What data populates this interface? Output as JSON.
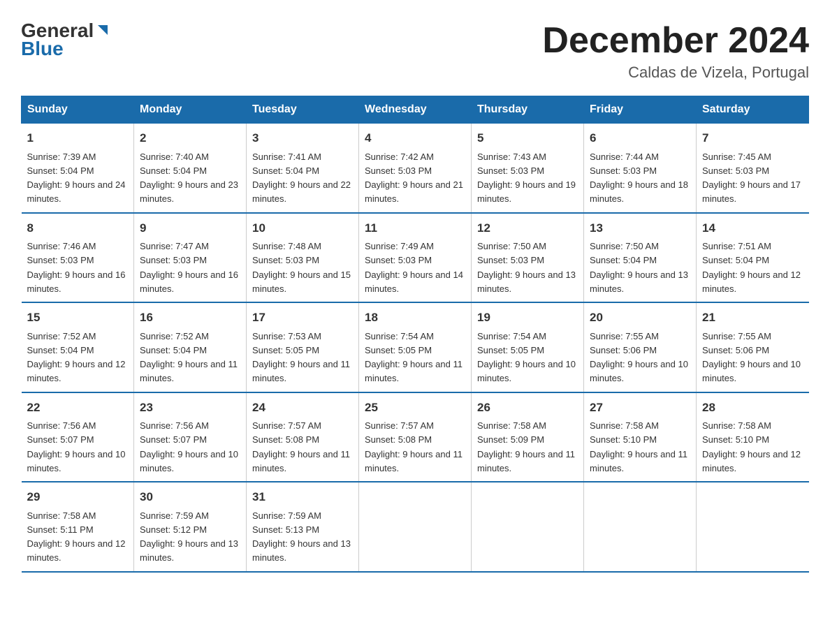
{
  "header": {
    "logo_general": "General",
    "logo_blue": "Blue",
    "month_title": "December 2024",
    "location": "Caldas de Vizela, Portugal"
  },
  "days_of_week": [
    "Sunday",
    "Monday",
    "Tuesday",
    "Wednesday",
    "Thursday",
    "Friday",
    "Saturday"
  ],
  "weeks": [
    [
      {
        "day": "1",
        "sunrise": "7:39 AM",
        "sunset": "5:04 PM",
        "daylight": "9 hours and 24 minutes."
      },
      {
        "day": "2",
        "sunrise": "7:40 AM",
        "sunset": "5:04 PM",
        "daylight": "9 hours and 23 minutes."
      },
      {
        "day": "3",
        "sunrise": "7:41 AM",
        "sunset": "5:04 PM",
        "daylight": "9 hours and 22 minutes."
      },
      {
        "day": "4",
        "sunrise": "7:42 AM",
        "sunset": "5:03 PM",
        "daylight": "9 hours and 21 minutes."
      },
      {
        "day": "5",
        "sunrise": "7:43 AM",
        "sunset": "5:03 PM",
        "daylight": "9 hours and 19 minutes."
      },
      {
        "day": "6",
        "sunrise": "7:44 AM",
        "sunset": "5:03 PM",
        "daylight": "9 hours and 18 minutes."
      },
      {
        "day": "7",
        "sunrise": "7:45 AM",
        "sunset": "5:03 PM",
        "daylight": "9 hours and 17 minutes."
      }
    ],
    [
      {
        "day": "8",
        "sunrise": "7:46 AM",
        "sunset": "5:03 PM",
        "daylight": "9 hours and 16 minutes."
      },
      {
        "day": "9",
        "sunrise": "7:47 AM",
        "sunset": "5:03 PM",
        "daylight": "9 hours and 16 minutes."
      },
      {
        "day": "10",
        "sunrise": "7:48 AM",
        "sunset": "5:03 PM",
        "daylight": "9 hours and 15 minutes."
      },
      {
        "day": "11",
        "sunrise": "7:49 AM",
        "sunset": "5:03 PM",
        "daylight": "9 hours and 14 minutes."
      },
      {
        "day": "12",
        "sunrise": "7:50 AM",
        "sunset": "5:03 PM",
        "daylight": "9 hours and 13 minutes."
      },
      {
        "day": "13",
        "sunrise": "7:50 AM",
        "sunset": "5:04 PM",
        "daylight": "9 hours and 13 minutes."
      },
      {
        "day": "14",
        "sunrise": "7:51 AM",
        "sunset": "5:04 PM",
        "daylight": "9 hours and 12 minutes."
      }
    ],
    [
      {
        "day": "15",
        "sunrise": "7:52 AM",
        "sunset": "5:04 PM",
        "daylight": "9 hours and 12 minutes."
      },
      {
        "day": "16",
        "sunrise": "7:52 AM",
        "sunset": "5:04 PM",
        "daylight": "9 hours and 11 minutes."
      },
      {
        "day": "17",
        "sunrise": "7:53 AM",
        "sunset": "5:05 PM",
        "daylight": "9 hours and 11 minutes."
      },
      {
        "day": "18",
        "sunrise": "7:54 AM",
        "sunset": "5:05 PM",
        "daylight": "9 hours and 11 minutes."
      },
      {
        "day": "19",
        "sunrise": "7:54 AM",
        "sunset": "5:05 PM",
        "daylight": "9 hours and 10 minutes."
      },
      {
        "day": "20",
        "sunrise": "7:55 AM",
        "sunset": "5:06 PM",
        "daylight": "9 hours and 10 minutes."
      },
      {
        "day": "21",
        "sunrise": "7:55 AM",
        "sunset": "5:06 PM",
        "daylight": "9 hours and 10 minutes."
      }
    ],
    [
      {
        "day": "22",
        "sunrise": "7:56 AM",
        "sunset": "5:07 PM",
        "daylight": "9 hours and 10 minutes."
      },
      {
        "day": "23",
        "sunrise": "7:56 AM",
        "sunset": "5:07 PM",
        "daylight": "9 hours and 10 minutes."
      },
      {
        "day": "24",
        "sunrise": "7:57 AM",
        "sunset": "5:08 PM",
        "daylight": "9 hours and 11 minutes."
      },
      {
        "day": "25",
        "sunrise": "7:57 AM",
        "sunset": "5:08 PM",
        "daylight": "9 hours and 11 minutes."
      },
      {
        "day": "26",
        "sunrise": "7:58 AM",
        "sunset": "5:09 PM",
        "daylight": "9 hours and 11 minutes."
      },
      {
        "day": "27",
        "sunrise": "7:58 AM",
        "sunset": "5:10 PM",
        "daylight": "9 hours and 11 minutes."
      },
      {
        "day": "28",
        "sunrise": "7:58 AM",
        "sunset": "5:10 PM",
        "daylight": "9 hours and 12 minutes."
      }
    ],
    [
      {
        "day": "29",
        "sunrise": "7:58 AM",
        "sunset": "5:11 PM",
        "daylight": "9 hours and 12 minutes."
      },
      {
        "day": "30",
        "sunrise": "7:59 AM",
        "sunset": "5:12 PM",
        "daylight": "9 hours and 13 minutes."
      },
      {
        "day": "31",
        "sunrise": "7:59 AM",
        "sunset": "5:13 PM",
        "daylight": "9 hours and 13 minutes."
      },
      null,
      null,
      null,
      null
    ]
  ]
}
